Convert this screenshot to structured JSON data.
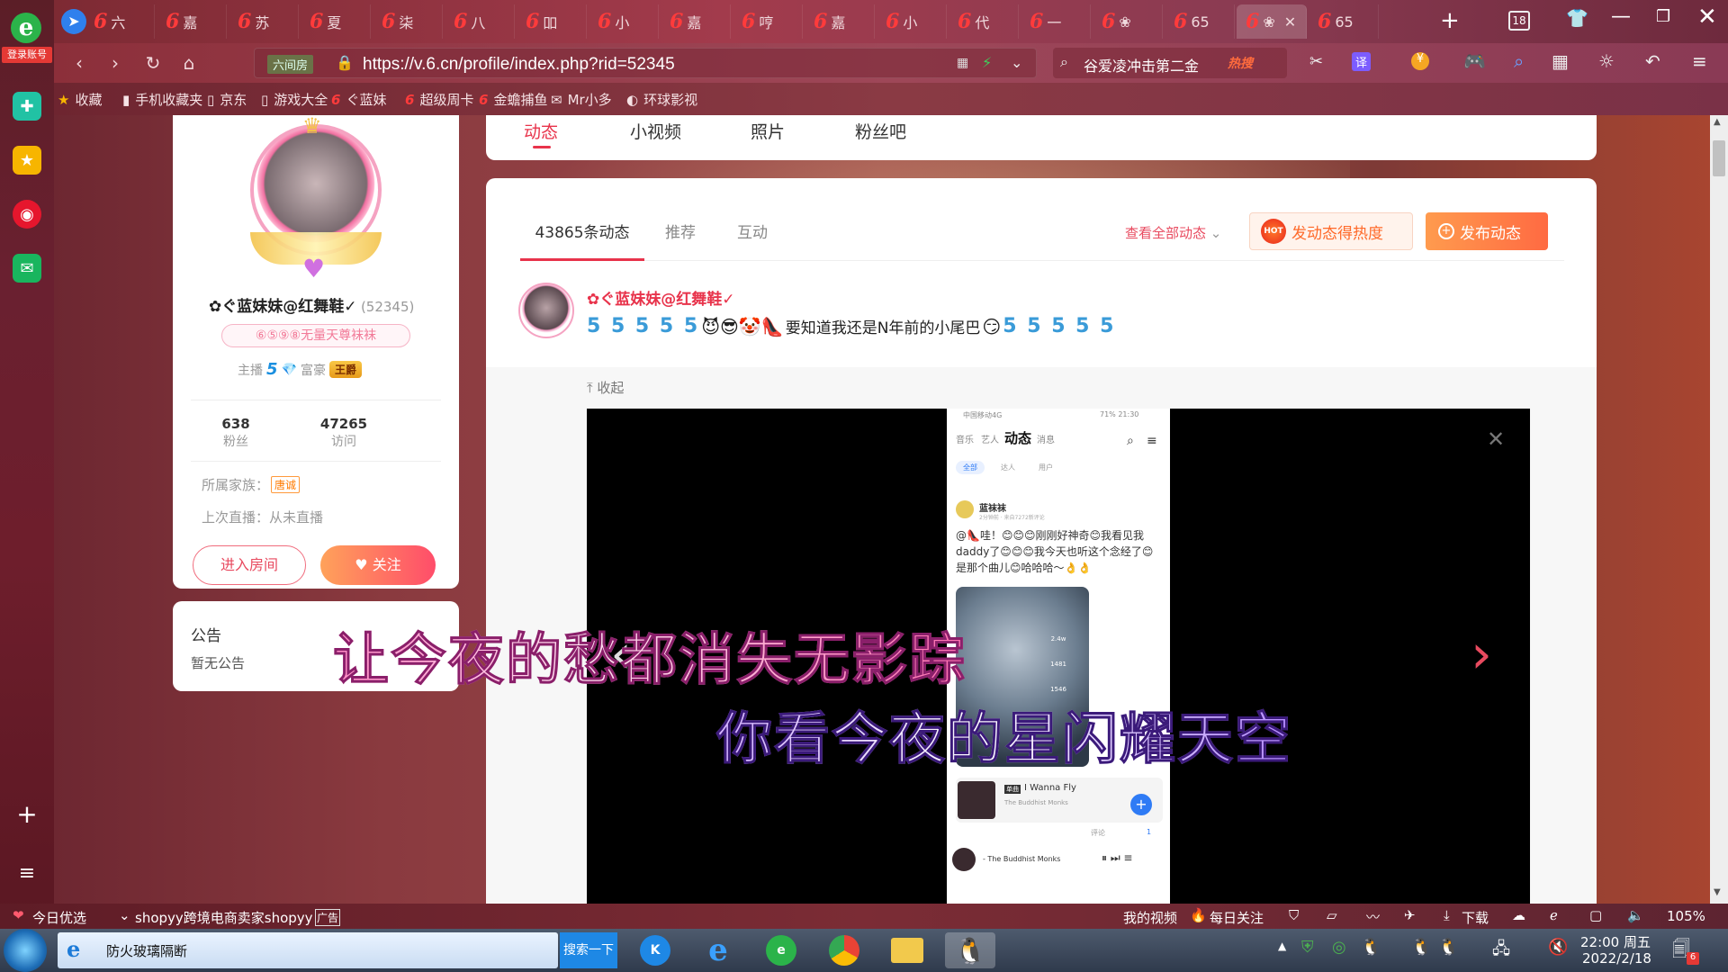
{
  "sidebar": {
    "login_label": "登录账号"
  },
  "tabs": [
    {
      "label": "六"
    },
    {
      "label": "嘉"
    },
    {
      "label": "苏"
    },
    {
      "label": "夏"
    },
    {
      "label": "柒"
    },
    {
      "label": "八"
    },
    {
      "label": "吅"
    },
    {
      "label": "小"
    },
    {
      "label": "嘉"
    },
    {
      "label": "哼"
    },
    {
      "label": "嘉"
    },
    {
      "label": "小"
    },
    {
      "label": "代"
    },
    {
      "label": "一"
    },
    {
      "label": "❀"
    },
    {
      "label": "65"
    },
    {
      "label": "❀"
    },
    {
      "label": "65"
    }
  ],
  "window": {
    "tab_count": "18"
  },
  "address_bar": {
    "site_badge": "六间房",
    "url": "https://v.6.cn/profile/index.php?rid=52345"
  },
  "search": {
    "placeholder": "谷爱凌冲击第二金",
    "hot_label": "热搜"
  },
  "bookmarks": [
    {
      "label": "收藏"
    },
    {
      "label": "手机收藏夹"
    },
    {
      "label": "京东"
    },
    {
      "label": "游戏大全"
    },
    {
      "label": "ぐ蓝妹"
    },
    {
      "label": "超级周卡"
    },
    {
      "label": "金蟾捕鱼"
    },
    {
      "label": "Mr小多"
    },
    {
      "label": "环球影视"
    }
  ],
  "profile_nav": {
    "tabs": [
      {
        "label": "动态"
      },
      {
        "label": "小视频"
      },
      {
        "label": "照片"
      },
      {
        "label": "粉丝吧"
      }
    ]
  },
  "profile": {
    "name": "✿ぐ蓝妹妹@红舞鞋✓",
    "rid": "(52345)",
    "tag": "⑥⑤⑨⑧无量天尊袜袜",
    "anchor_label": "主播",
    "anchor_level": "5",
    "rich_label": "富豪",
    "rich_badge": "王爵",
    "fans_count": "638",
    "fans_label": "粉丝",
    "visits_count": "47265",
    "visits_label": "访问",
    "family_label": "所属家族：",
    "family_value": "唐诚",
    "last_live_label": "上次直播：从未直播",
    "enter_room": "进入房间",
    "follow": "关注"
  },
  "announcement": {
    "title": "公告",
    "body": "暂无公告"
  },
  "feed": {
    "tabs": [
      {
        "label": "43865条动态"
      },
      {
        "label": "推荐"
      },
      {
        "label": "互动"
      }
    ],
    "view_all": "查看全部动态",
    "hot_button": "发动态得热度",
    "hot_badge": "HOT",
    "publish_button": "发布动态",
    "post": {
      "author": "✿ぐ蓝妹妹@红舞鞋✓",
      "text": "要知道我还是N年前的小尾巴",
      "fold": "收起"
    }
  },
  "phone_screen": {
    "status_left": "中国移动4G",
    "status_right": "71% 21:30",
    "nav": [
      {
        "label": "音乐"
      },
      {
        "label": "艺人"
      },
      {
        "label": "动态"
      },
      {
        "label": "消息"
      }
    ],
    "filters": [
      {
        "label": "全部"
      },
      {
        "label": "达人"
      },
      {
        "label": "用户"
      }
    ],
    "user": "蓝袜袜",
    "user_meta": "2分钟前 · 来自7272新评论",
    "text": "@👠哇！😊😊😊刚刚好神奇😊我看见我daddy了😊😊😊我今天也听这个念经了😊是那个曲儿😊哈哈哈～👌👌",
    "side_counts": [
      {
        "value": "2.4w"
      },
      {
        "value": "1481"
      },
      {
        "value": "1546"
      }
    ],
    "song_tag": "单曲",
    "song_title": "I Wanna Fly",
    "song_artist": "The Buddhist Monks",
    "comment_label": "评论",
    "like_count": "1",
    "player_text": "- The Buddhist Monks"
  },
  "lyrics": {
    "line1": "让今夜的愁都消失无影踪",
    "line2": "你看今夜的星闪耀天空"
  },
  "status_bar": {
    "left1": "今日优选",
    "left2": "shopyy跨境电商卖家shopyy",
    "ad": "广告",
    "my_video": "我的视频",
    "daily_follow": "每日关注",
    "download": "下载",
    "zoom": "105%"
  },
  "taskbar": {
    "ie_label": "防火玻璃隔断",
    "search_label": "搜索一下",
    "time": "22:00 周五",
    "date": "2022/2/18",
    "notif_count": "6"
  },
  "colors": {
    "accent": "#ff4d6a",
    "orange": "#ff7a45",
    "brand_red": "#e02e3a"
  }
}
